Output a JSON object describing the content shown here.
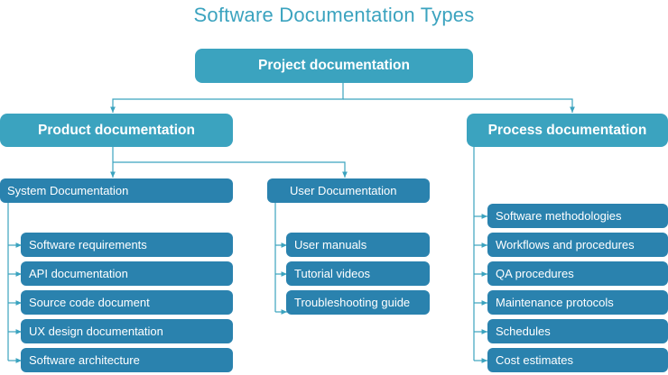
{
  "title": "Software Documentation Types",
  "root": "Project documentation",
  "product": {
    "label": "Product documentation",
    "system": {
      "label": "System Documentation",
      "items": [
        "Software requirements",
        "API documentation",
        "Source code document",
        "UX design documentation",
        "Software architecture"
      ]
    },
    "user": {
      "label": "User Documentation",
      "items": [
        "User manuals",
        "Tutorial videos",
        "Troubleshooting guide"
      ]
    }
  },
  "process": {
    "label": "Process documentation",
    "items": [
      "Software methodologies",
      "Workflows and procedures",
      "QA procedures",
      "Maintenance protocols",
      "Schedules",
      "Cost estimates"
    ]
  },
  "colors": {
    "title": "#3ba3bf",
    "top_nodes": "#3ba3bf",
    "sub_nodes": "#2a82ae",
    "connectors": "#3ba3bf"
  }
}
